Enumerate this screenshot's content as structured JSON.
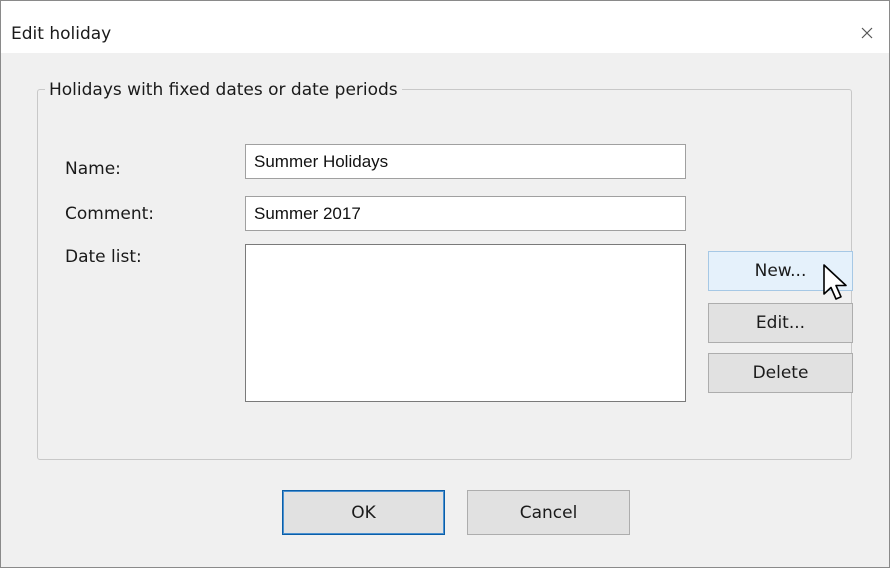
{
  "dialog": {
    "title": "Edit holiday",
    "close_icon": "close-icon"
  },
  "group": {
    "title": "Holidays with fixed dates or date periods"
  },
  "fields": {
    "name_label": "Name:",
    "name_value": "Summer Holidays",
    "comment_label": "Comment:",
    "comment_value": "Summer 2017",
    "date_list_label": "Date list:",
    "date_list_items": []
  },
  "side_buttons": {
    "new_label": "New...",
    "edit_label": "Edit...",
    "delete_label": "Delete"
  },
  "footer": {
    "ok_label": "OK",
    "cancel_label": "Cancel"
  },
  "cursor": {
    "icon": "arrow-pointer-icon"
  }
}
